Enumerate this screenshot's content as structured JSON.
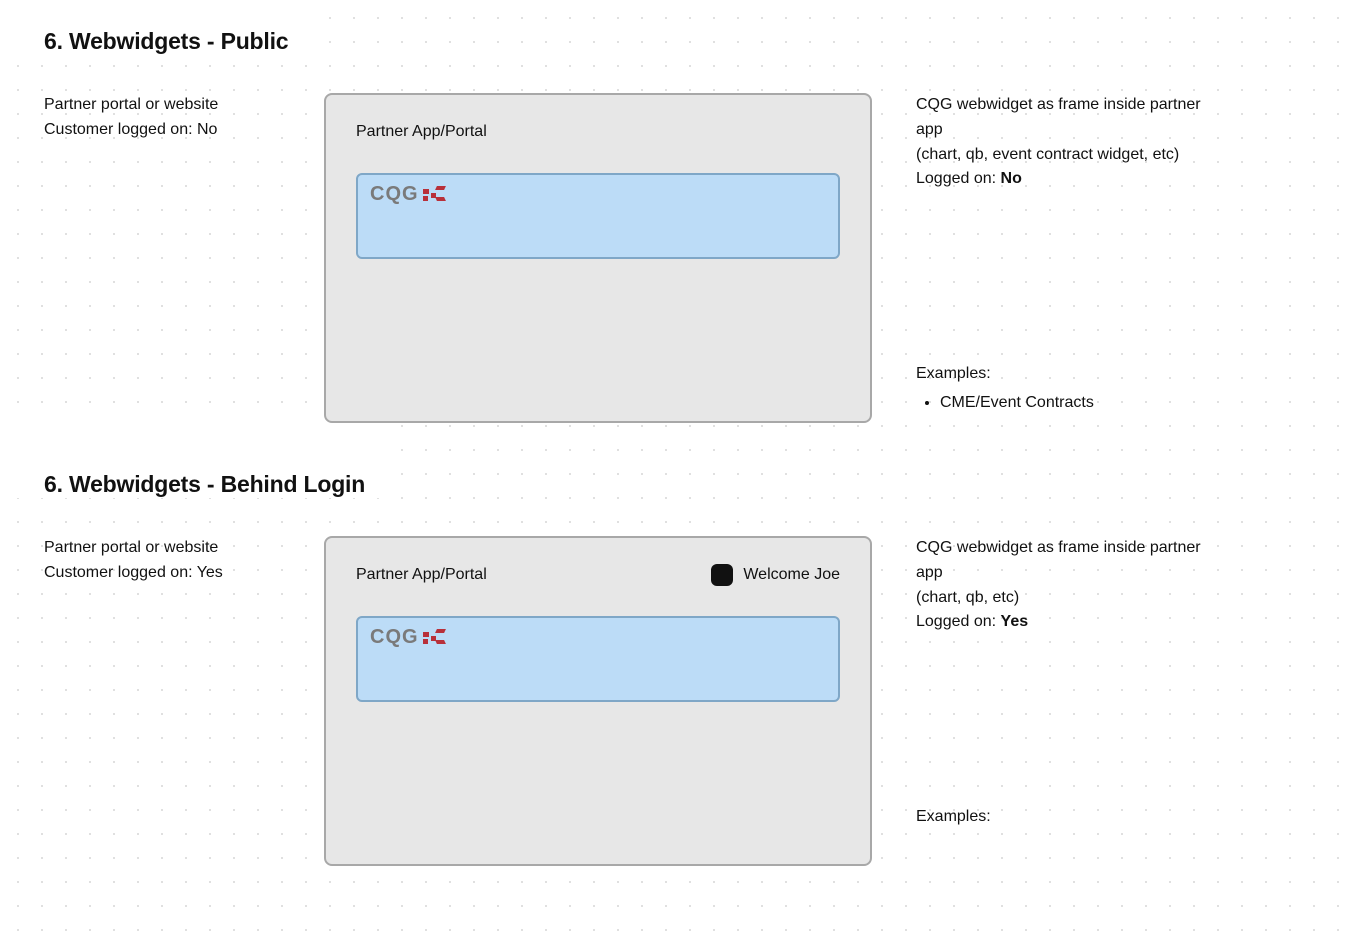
{
  "section1": {
    "heading": "6. Webwidgets - Public",
    "left": {
      "line1": "Partner portal or website",
      "line2": "Customer logged on: No"
    },
    "panel": {
      "title": "Partner App/Portal",
      "logo_text": "CQG"
    },
    "right": {
      "line1": "CQG webwidget as frame inside partner app",
      "line2": "(chart, qb, event contract widget, etc)",
      "logged_label": "Logged on: ",
      "logged_value": "No",
      "examples_label": "Examples:",
      "examples": [
        "CME/Event Contracts"
      ]
    }
  },
  "section2": {
    "heading": "6. Webwidgets - Behind Login",
    "left": {
      "line1": "Partner portal or website",
      "line2": "Customer logged on: Yes"
    },
    "panel": {
      "title": "Partner App/Portal",
      "welcome": "Welcome Joe",
      "logo_text": "CQG"
    },
    "right": {
      "line1": "CQG webwidget as frame inside partner app",
      "line2": "(chart, qb, etc)",
      "logged_label": "Logged on: ",
      "logged_value": "Yes",
      "examples_label": "Examples:"
    }
  }
}
